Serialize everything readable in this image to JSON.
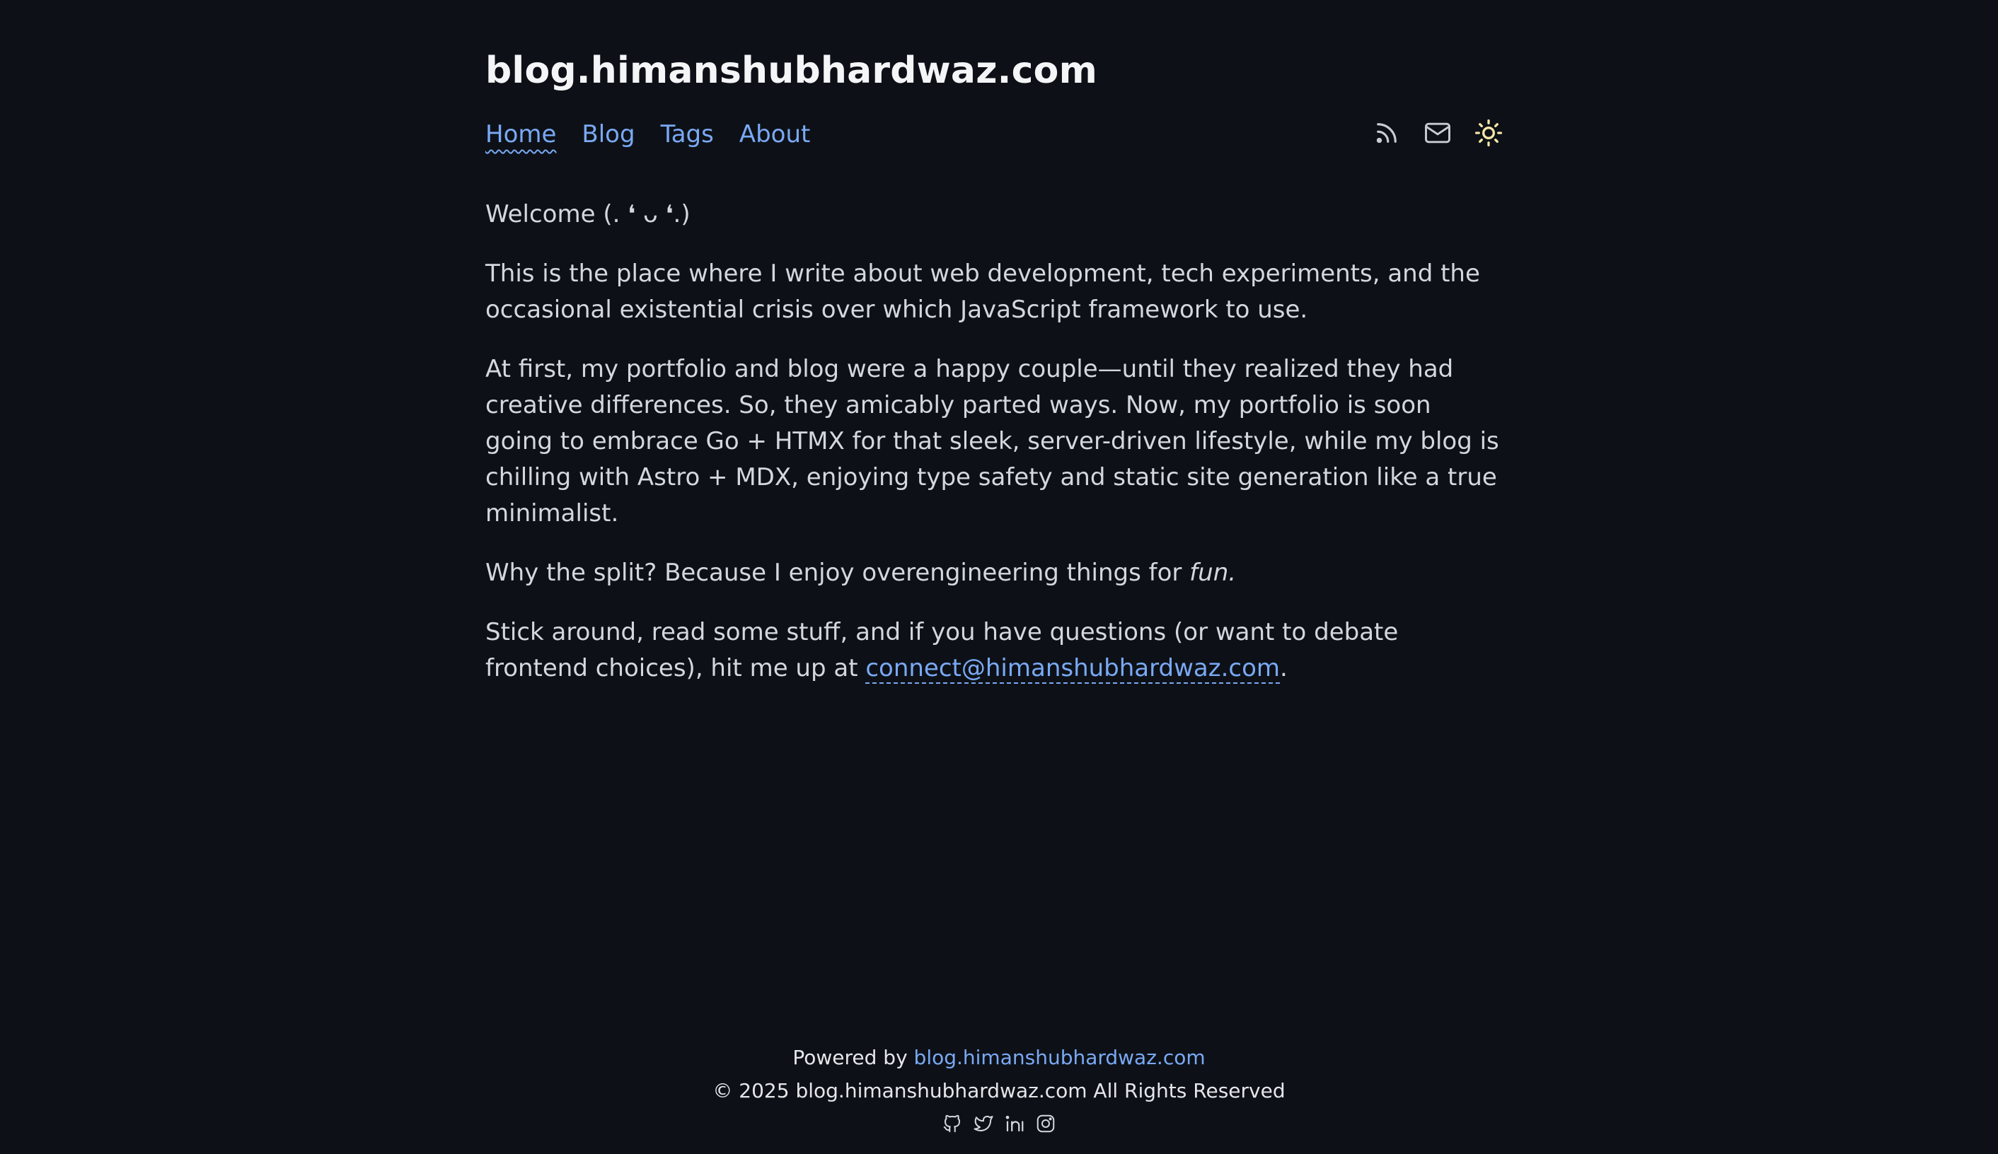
{
  "site": {
    "title": "blog.himanshubhardwaz.com"
  },
  "nav": {
    "items": [
      {
        "label": "Home",
        "active": true
      },
      {
        "label": "Blog",
        "active": false
      },
      {
        "label": "Tags",
        "active": false
      },
      {
        "label": "About",
        "active": false
      }
    ]
  },
  "toolbar": {
    "icons": [
      "rss-icon",
      "mail-icon",
      "sun-icon"
    ]
  },
  "main": {
    "welcome": "Welcome (. ❛ ᴗ ❛.)",
    "p1": "This is the place where I write about web development, tech experiments, and the occasional existential crisis over which JavaScript framework to use.",
    "p2": "At first, my portfolio and blog were a happy couple—until they realized they had creative differences. So, they amicably parted ways. Now, my portfolio is soon going to embrace Go + HTMX for that sleek, server-driven lifestyle, while my blog is chilling with Astro + MDX, enjoying type safety and static site generation like a true minimalist.",
    "p3_text": "Why the split? Because I enjoy overengineering things for ",
    "p3_emphasis": "fun.",
    "p4_text": "Stick around, read some stuff, and if you have questions (or want to debate frontend choices), hit me up at ",
    "p4_email": "connect@himanshubhardwaz.com",
    "p4_end": "."
  },
  "footer": {
    "powered_prefix": "Powered by ",
    "powered_link": "blog.himanshubhardwaz.com",
    "copyright": "© 2025 blog.himanshubhardwaz.com All Rights Reserved",
    "social_icons": [
      "github-icon",
      "twitter-icon",
      "linkedin-icon",
      "instagram-icon"
    ]
  },
  "colors": {
    "background": "#0d1117",
    "text": "#d4d7dc",
    "accent": "#7aa9f5",
    "sun": "#f7e7a8"
  }
}
